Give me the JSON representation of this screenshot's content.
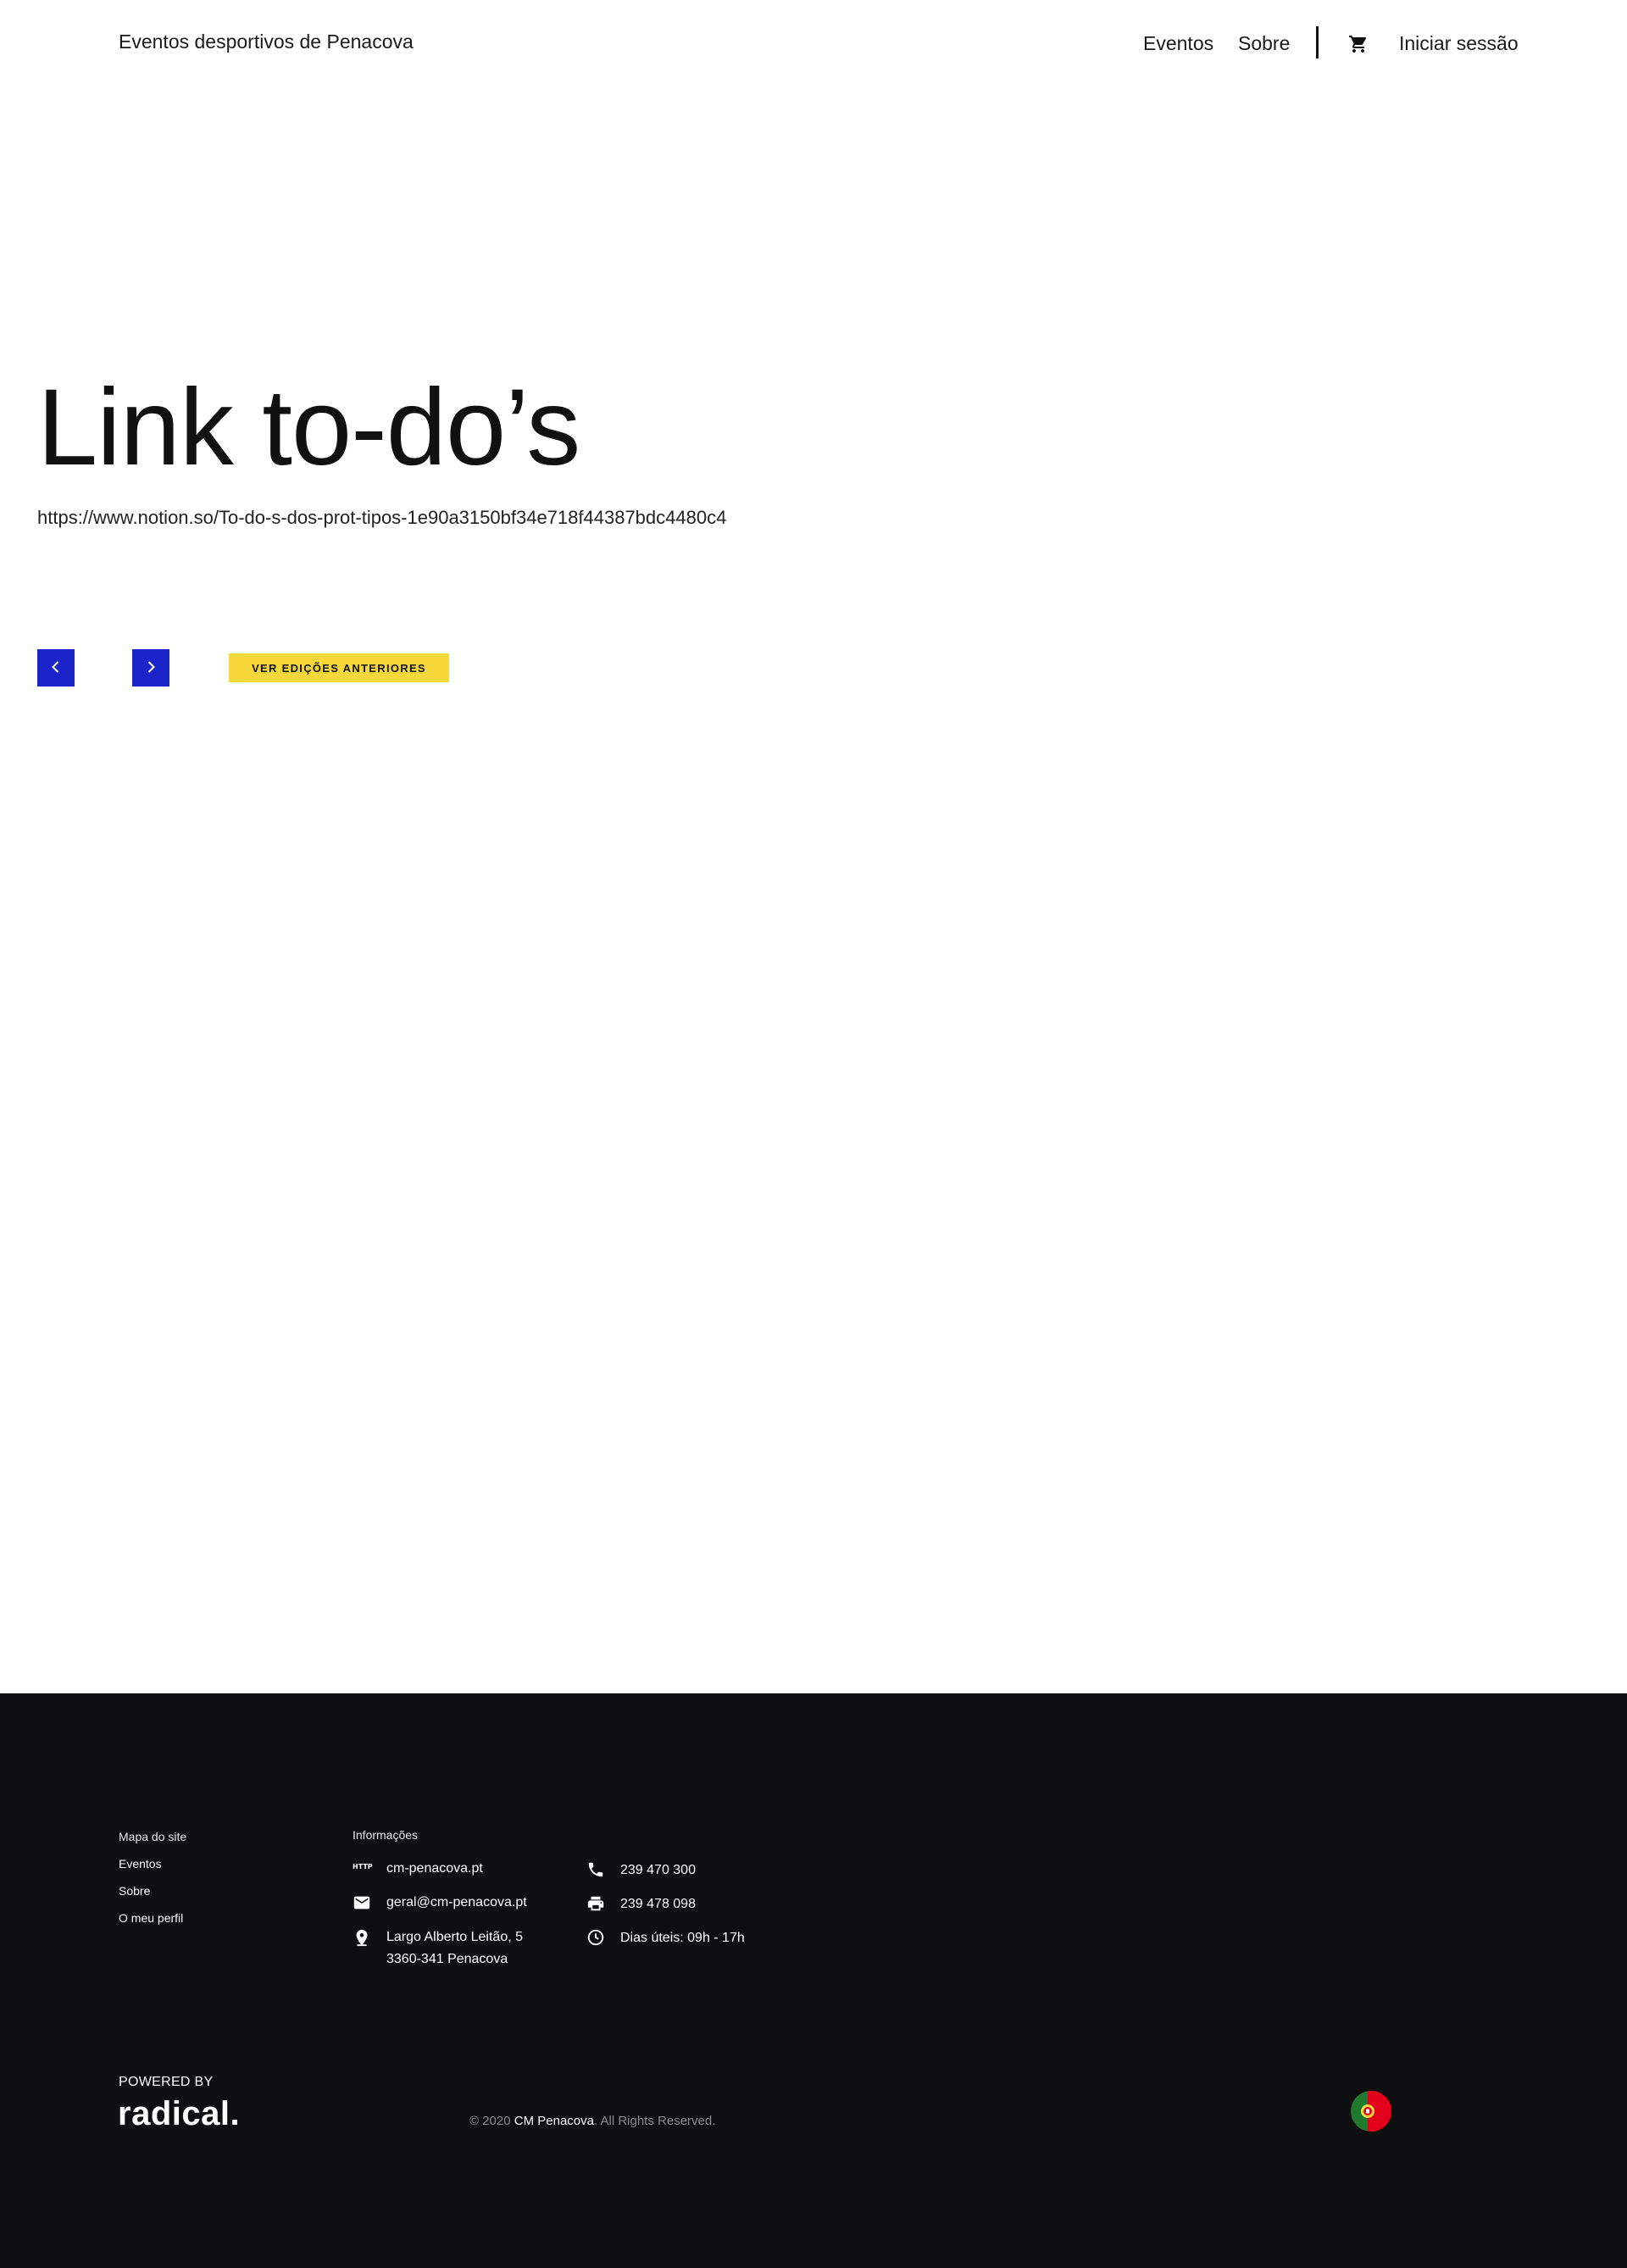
{
  "header": {
    "site_title": "Eventos desportivos de Penacova",
    "nav": {
      "eventos": "Eventos",
      "sobre": "Sobre",
      "login": "Iniciar sessão"
    },
    "cart_icon": "shopping-cart-icon"
  },
  "main": {
    "title": "Link to-do’s",
    "link": "https://www.notion.so/To-do-s-dos-prot-tipos-1e90a3150bf34e718f44387bdc4480c4",
    "prev_icon": "chevron-left-icon",
    "next_icon": "chevron-right-icon",
    "editions_button": "VER EDIÇÕES ANTERIORES"
  },
  "footer": {
    "sitemap": {
      "heading": "Mapa do site",
      "links": [
        "Eventos",
        "Sobre",
        "O meu perfil"
      ]
    },
    "info": {
      "heading": "Informações",
      "website": "cm-penacova.pt",
      "email": "geral@cm-penacova.pt",
      "address_line1": "Largo Alberto Leitão, 5",
      "address_line2": "3360-341 Penacova",
      "phone": "239 470 300",
      "fax": "239 478 098",
      "hours": "Dias úteis: 09h - 17h",
      "http_icon_label": "HTTP"
    },
    "powered_by": "POWERED BY",
    "brand": "radical.",
    "copyright_prefix": "© 2020 ",
    "copyright_brand": "CM Penacova",
    "copyright_suffix": ". All Rights Reserved.",
    "language_flag": "portugal-flag-icon"
  },
  "colors": {
    "accent_blue": "#1a24c9",
    "accent_yellow": "#f7d83a",
    "footer_bg": "#0d0f10"
  }
}
